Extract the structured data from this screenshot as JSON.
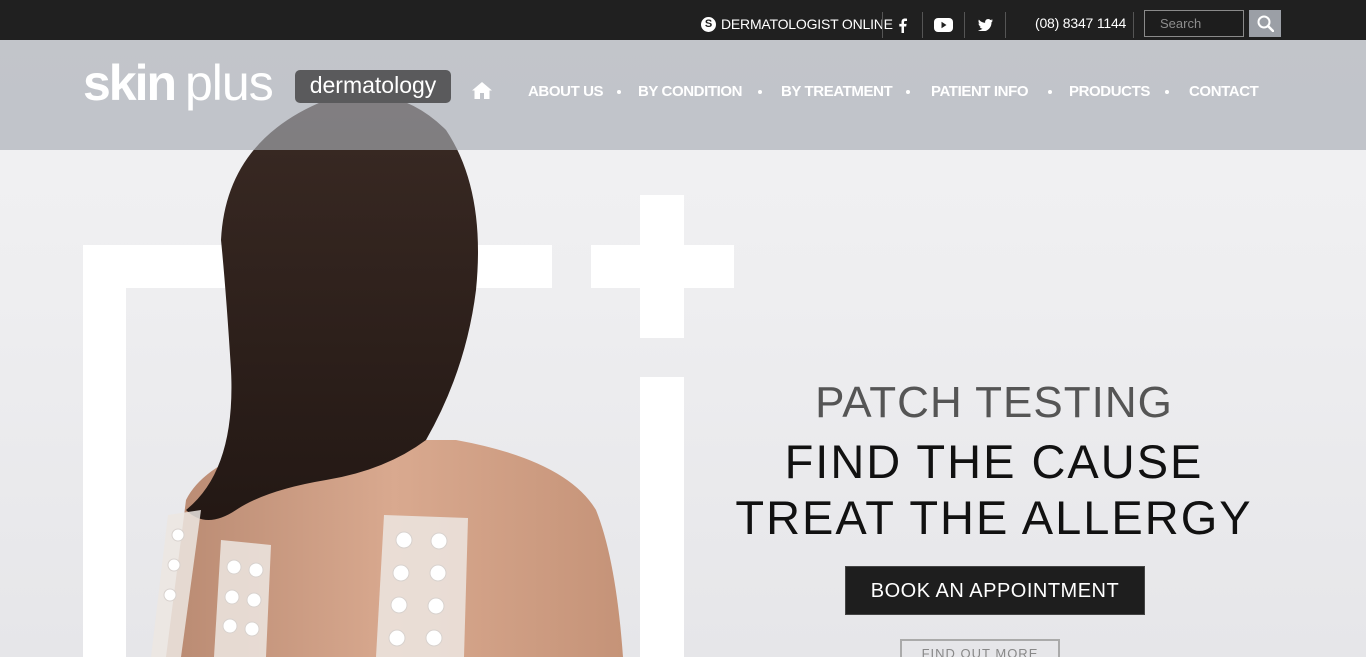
{
  "topbar": {
    "skype_label": "DERMATOLOGIST ONLINE",
    "phone": "(08) 8347 1144",
    "search_placeholder": "Search",
    "social": [
      "facebook-icon",
      "youtube-icon",
      "twitter-icon"
    ]
  },
  "header": {
    "logo_skin": "skin",
    "logo_plus": "plus",
    "logo_badge": "dermatology",
    "nav": [
      "ABOUT US",
      "BY CONDITION",
      "BY TREATMENT",
      "PATIENT INFO",
      "PRODUCTS",
      "CONTACT"
    ]
  },
  "hero": {
    "subtitle": "PATCH TESTING",
    "title_line1": "FIND THE CAUSE",
    "title_line2": "TREAT THE ALLERGY",
    "cta_book": "BOOK AN APPOINTMENT",
    "cta_more": "FIND OUT MORE"
  },
  "colors": {
    "topbar": "#202020",
    "header_overlay": "#a8acb4",
    "badge": "#5a5a5c",
    "button_dark": "#1e1e1e"
  }
}
